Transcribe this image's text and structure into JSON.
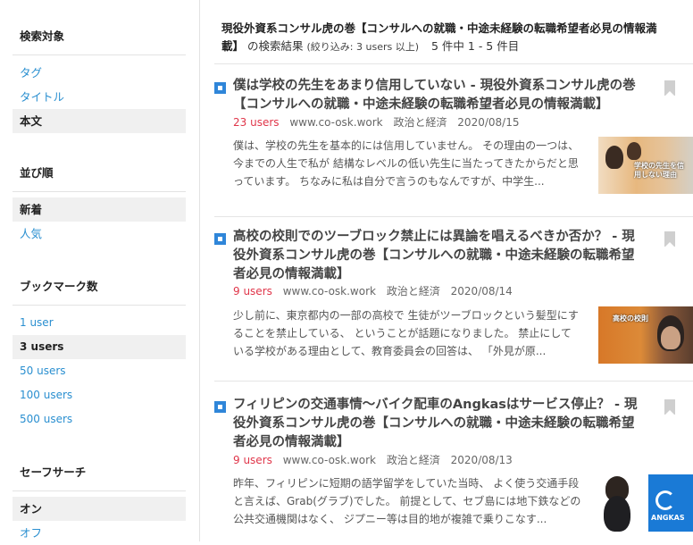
{
  "sidebar": {
    "target": {
      "heading": "検索対象",
      "items": [
        "タグ",
        "タイトル",
        "本文"
      ],
      "active": 2
    },
    "sort": {
      "heading": "並び順",
      "items": [
        "新着",
        "人気"
      ],
      "active": 0
    },
    "bookmarks": {
      "heading": "ブックマーク数",
      "items": [
        "1 user",
        "3 users",
        "50 users",
        "100 users",
        "500 users"
      ],
      "active": 1
    },
    "safesearch": {
      "heading": "セーフサーチ",
      "items": [
        "オン",
        "オフ"
      ],
      "active": 0
    }
  },
  "header": {
    "query": "現役外資系コンサル虎の巻【コンサルへの就職・中途未経験の転職希望者必見の情報満載】",
    "suffix": "の検索結果",
    "filter": "(絞り込み: 3 users 以上)",
    "count": "5 件中 1 - 5 件目"
  },
  "results": [
    {
      "title": "僕は学校の先生をあまり信用していない - 現役外資系コンサル虎の巻【コンサルへの就職・中途未経験の転職希望者必見の情報満載】",
      "users": "23 users",
      "domain": "www.co-osk.work",
      "category": "政治と経済",
      "date": "2020/08/15",
      "snippet": "僕は、学校の先生を基本的には信用していません。 その理由の一つは、今までの人生で私が 結構なレベルの低い先生に当たってきたからだと思っています。 ちなみに私は自分で言うのもなんですが、中学生...",
      "thumb_text": "学校の先生を信用しない理由"
    },
    {
      "title": "高校の校則でのツーブロック禁止には異論を唱えるべきか否か？ - 現役外資系コンサル虎の巻【コンサルへの就職・中途未経験の転職希望者必見の情報満載】",
      "users": "9 users",
      "domain": "www.co-osk.work",
      "category": "政治と経済",
      "date": "2020/08/14",
      "snippet": "少し前に、東京都内の一部の高校で 生徒がツーブロックという髪型にすることを禁止している、 ということが話題になりました。 禁止にしている学校がある理由として、教育委員会の回答は、 「外見が原...",
      "thumb_text": "高校の校則"
    },
    {
      "title": "フィリピンの交通事情～バイク配車のAngkasはサービス停止？ - 現役外資系コンサル虎の巻【コンサルへの就職・中途未経験の転職希望者必見の情報満載】",
      "users": "9 users",
      "domain": "www.co-osk.work",
      "category": "政治と経済",
      "date": "2020/08/13",
      "snippet": "昨年、フィリピンに短期の語学留学をしていた当時、 よく使う交通手段と言えば、Grab(グラブ)でした。 前提として、セブ島には地下鉄などの公共交通機関はなく、 ジプニー等は目的地が複雑で乗りこなす...",
      "thumb_text": "ANGKAS"
    }
  ]
}
